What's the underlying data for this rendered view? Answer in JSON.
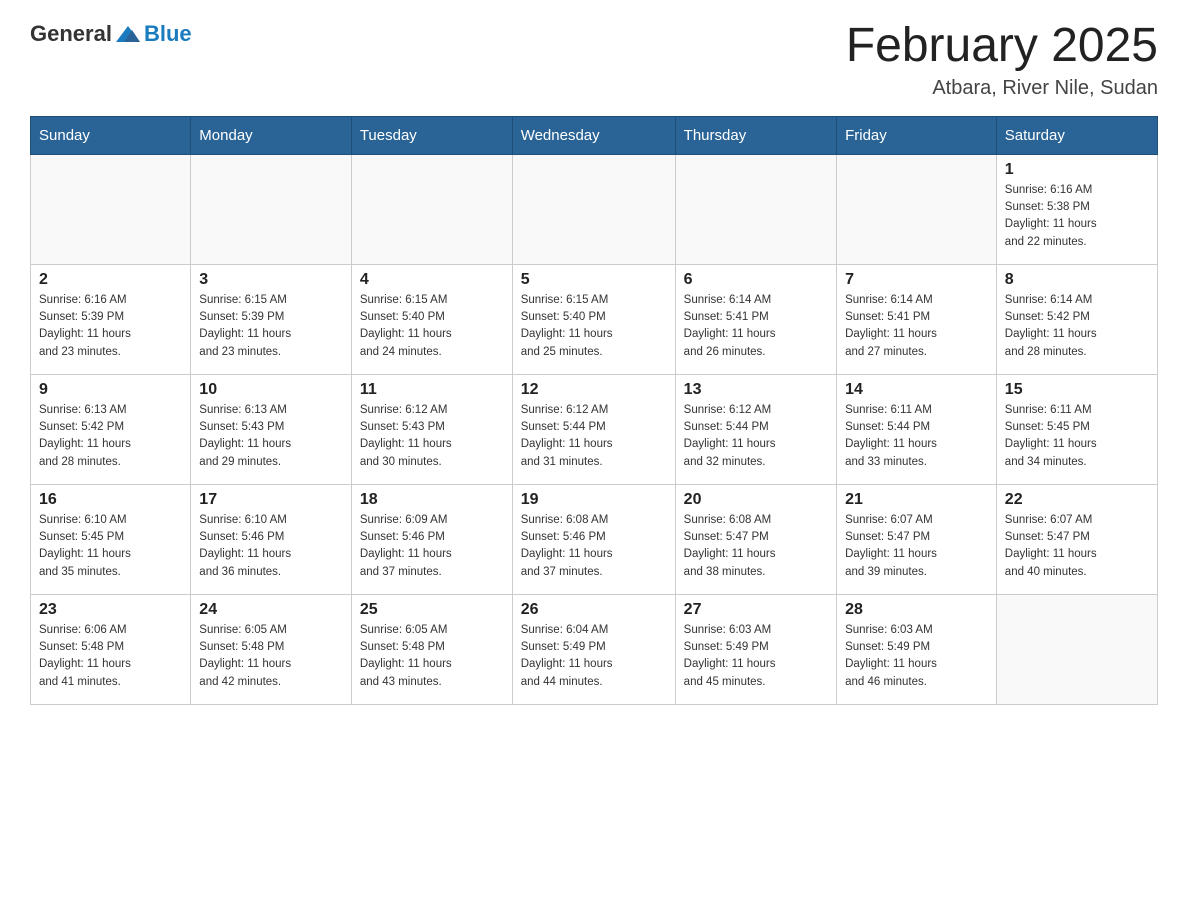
{
  "header": {
    "logo_general": "General",
    "logo_blue": "Blue",
    "month_title": "February 2025",
    "subtitle": "Atbara, River Nile, Sudan"
  },
  "weekdays": [
    "Sunday",
    "Monday",
    "Tuesday",
    "Wednesday",
    "Thursday",
    "Friday",
    "Saturday"
  ],
  "weeks": [
    [
      {
        "day": "",
        "info": ""
      },
      {
        "day": "",
        "info": ""
      },
      {
        "day": "",
        "info": ""
      },
      {
        "day": "",
        "info": ""
      },
      {
        "day": "",
        "info": ""
      },
      {
        "day": "",
        "info": ""
      },
      {
        "day": "1",
        "info": "Sunrise: 6:16 AM\nSunset: 5:38 PM\nDaylight: 11 hours\nand 22 minutes."
      }
    ],
    [
      {
        "day": "2",
        "info": "Sunrise: 6:16 AM\nSunset: 5:39 PM\nDaylight: 11 hours\nand 23 minutes."
      },
      {
        "day": "3",
        "info": "Sunrise: 6:15 AM\nSunset: 5:39 PM\nDaylight: 11 hours\nand 23 minutes."
      },
      {
        "day": "4",
        "info": "Sunrise: 6:15 AM\nSunset: 5:40 PM\nDaylight: 11 hours\nand 24 minutes."
      },
      {
        "day": "5",
        "info": "Sunrise: 6:15 AM\nSunset: 5:40 PM\nDaylight: 11 hours\nand 25 minutes."
      },
      {
        "day": "6",
        "info": "Sunrise: 6:14 AM\nSunset: 5:41 PM\nDaylight: 11 hours\nand 26 minutes."
      },
      {
        "day": "7",
        "info": "Sunrise: 6:14 AM\nSunset: 5:41 PM\nDaylight: 11 hours\nand 27 minutes."
      },
      {
        "day": "8",
        "info": "Sunrise: 6:14 AM\nSunset: 5:42 PM\nDaylight: 11 hours\nand 28 minutes."
      }
    ],
    [
      {
        "day": "9",
        "info": "Sunrise: 6:13 AM\nSunset: 5:42 PM\nDaylight: 11 hours\nand 28 minutes."
      },
      {
        "day": "10",
        "info": "Sunrise: 6:13 AM\nSunset: 5:43 PM\nDaylight: 11 hours\nand 29 minutes."
      },
      {
        "day": "11",
        "info": "Sunrise: 6:12 AM\nSunset: 5:43 PM\nDaylight: 11 hours\nand 30 minutes."
      },
      {
        "day": "12",
        "info": "Sunrise: 6:12 AM\nSunset: 5:44 PM\nDaylight: 11 hours\nand 31 minutes."
      },
      {
        "day": "13",
        "info": "Sunrise: 6:12 AM\nSunset: 5:44 PM\nDaylight: 11 hours\nand 32 minutes."
      },
      {
        "day": "14",
        "info": "Sunrise: 6:11 AM\nSunset: 5:44 PM\nDaylight: 11 hours\nand 33 minutes."
      },
      {
        "day": "15",
        "info": "Sunrise: 6:11 AM\nSunset: 5:45 PM\nDaylight: 11 hours\nand 34 minutes."
      }
    ],
    [
      {
        "day": "16",
        "info": "Sunrise: 6:10 AM\nSunset: 5:45 PM\nDaylight: 11 hours\nand 35 minutes."
      },
      {
        "day": "17",
        "info": "Sunrise: 6:10 AM\nSunset: 5:46 PM\nDaylight: 11 hours\nand 36 minutes."
      },
      {
        "day": "18",
        "info": "Sunrise: 6:09 AM\nSunset: 5:46 PM\nDaylight: 11 hours\nand 37 minutes."
      },
      {
        "day": "19",
        "info": "Sunrise: 6:08 AM\nSunset: 5:46 PM\nDaylight: 11 hours\nand 37 minutes."
      },
      {
        "day": "20",
        "info": "Sunrise: 6:08 AM\nSunset: 5:47 PM\nDaylight: 11 hours\nand 38 minutes."
      },
      {
        "day": "21",
        "info": "Sunrise: 6:07 AM\nSunset: 5:47 PM\nDaylight: 11 hours\nand 39 minutes."
      },
      {
        "day": "22",
        "info": "Sunrise: 6:07 AM\nSunset: 5:47 PM\nDaylight: 11 hours\nand 40 minutes."
      }
    ],
    [
      {
        "day": "23",
        "info": "Sunrise: 6:06 AM\nSunset: 5:48 PM\nDaylight: 11 hours\nand 41 minutes."
      },
      {
        "day": "24",
        "info": "Sunrise: 6:05 AM\nSunset: 5:48 PM\nDaylight: 11 hours\nand 42 minutes."
      },
      {
        "day": "25",
        "info": "Sunrise: 6:05 AM\nSunset: 5:48 PM\nDaylight: 11 hours\nand 43 minutes."
      },
      {
        "day": "26",
        "info": "Sunrise: 6:04 AM\nSunset: 5:49 PM\nDaylight: 11 hours\nand 44 minutes."
      },
      {
        "day": "27",
        "info": "Sunrise: 6:03 AM\nSunset: 5:49 PM\nDaylight: 11 hours\nand 45 minutes."
      },
      {
        "day": "28",
        "info": "Sunrise: 6:03 AM\nSunset: 5:49 PM\nDaylight: 11 hours\nand 46 minutes."
      },
      {
        "day": "",
        "info": ""
      }
    ]
  ]
}
